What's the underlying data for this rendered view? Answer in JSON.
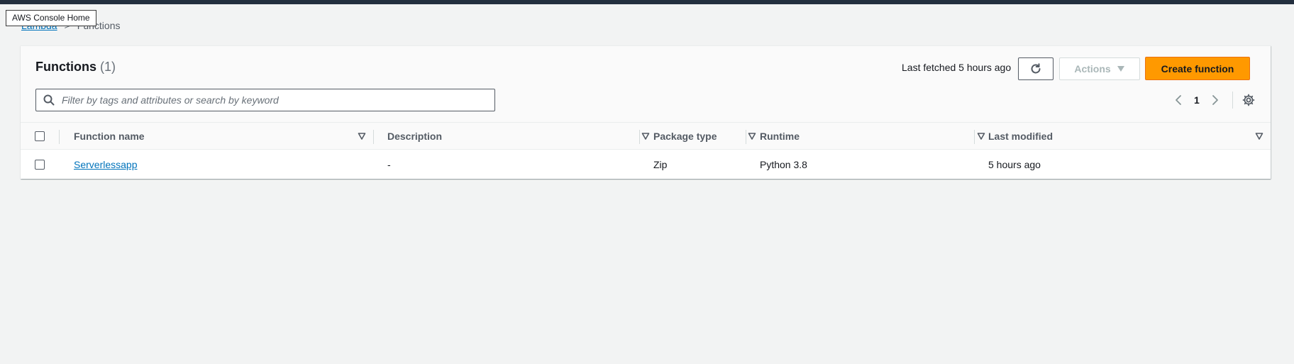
{
  "tooltip": "AWS Console Home",
  "breadcrumb": {
    "parent": "Lambda",
    "separator": ">",
    "current": "Functions"
  },
  "panel": {
    "title": "Functions",
    "count": "(1)",
    "last_fetched": "Last fetched 5 hours ago",
    "actions_label": "Actions",
    "create_label": "Create function",
    "search_placeholder": "Filter by tags and attributes or search by keyword",
    "page_number": "1"
  },
  "table": {
    "columns": [
      "Function name",
      "Description",
      "Package type",
      "Runtime",
      "Last modified"
    ],
    "rows": [
      {
        "name": "Serverlessapp",
        "description": "-",
        "package_type": "Zip",
        "runtime": "Python 3.8",
        "last_modified": "5 hours ago"
      }
    ]
  },
  "colors": {
    "accent": "#ff9900",
    "link": "#0073bb",
    "topbar": "#232f3e",
    "background": "#f2f3f3"
  }
}
